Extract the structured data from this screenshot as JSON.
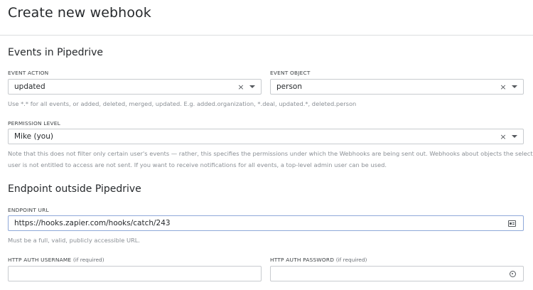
{
  "page": {
    "title": "Create new webhook"
  },
  "events_section": {
    "title": "Events in Pipedrive",
    "event_action": {
      "label": "EVENT ACTION",
      "value": "updated"
    },
    "event_object": {
      "label": "EVENT OBJECT",
      "value": "person"
    },
    "events_help": "Use *.* for all events, or added, deleted, merged, updated. E.g. added.organization, *.deal, updated.*, deleted.person",
    "permission_level": {
      "label": "PERMISSION LEVEL",
      "value": "Mike (you)"
    },
    "permission_help_line1": "Note that this does not filter only certain user's events — rather, this specifies the permissions under which the Webhooks are being sent out. Webhooks about objects the selected",
    "permission_help_line2": "user is not entitled to access are not sent. If you want to receive notifications for all events, a top-level admin user can be used."
  },
  "endpoint_section": {
    "title": "Endpoint outside Pipedrive",
    "endpoint_url": {
      "label": "ENDPOINT URL",
      "value": "https://hooks.zapier.com/hooks/catch/243"
    },
    "endpoint_help": "Must be a full, valid, publicly accessible URL.",
    "auth_username": {
      "label": "HTTP AUTH USERNAME",
      "suffix": "(if required)",
      "value": ""
    },
    "auth_password": {
      "label": "HTTP AUTH PASSWORD",
      "suffix": "(if required)",
      "value": ""
    }
  },
  "icons": {
    "clear": "×",
    "dropdown": "chevron-down-icon",
    "autofill": "id-card-icon",
    "password": "key-icon"
  },
  "colors": {
    "focus_border": "#8fa9d9",
    "border": "#c8cbcf",
    "help_text": "#8a8f95"
  }
}
